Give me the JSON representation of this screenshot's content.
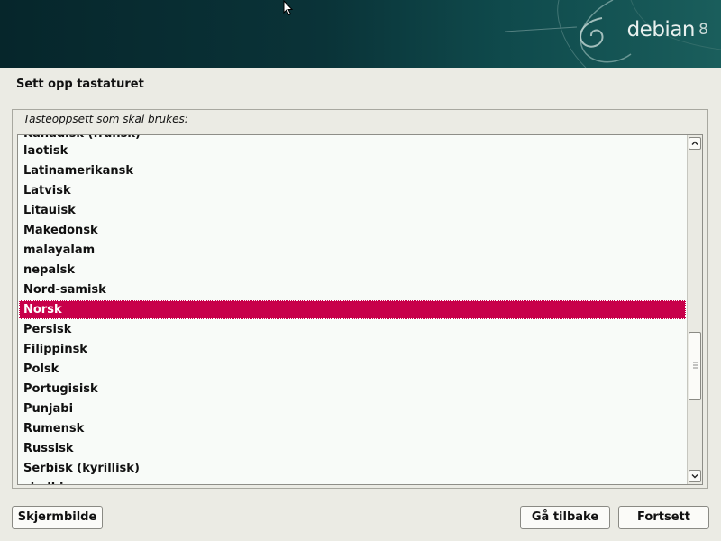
{
  "header": {
    "logo_text": "debian",
    "logo_version": "8"
  },
  "page": {
    "title": "Sett opp tastaturet"
  },
  "keyboard_list": {
    "legend": "Tasteoppsett som skal brukes:",
    "partial_top": "Kanadisk (fransk)",
    "items": [
      "laotisk",
      "Latinamerikansk",
      "Latvisk",
      "Litauisk",
      "Makedonsk",
      "malayalam",
      "nepalsk",
      "Nord-samisk",
      "Norsk",
      "Persisk",
      "Filippinsk",
      "Polsk",
      "Portugisisk",
      "Punjabi",
      "Rumensk",
      "Russisk",
      "Serbisk (kyrillisk)"
    ],
    "partial_bottom": "sindhi",
    "selected": "Norsk",
    "colors": {
      "selected_bg": "#c8004a",
      "selected_fg": "#ffffff"
    }
  },
  "buttons": {
    "screenshot": "Skjermbilde",
    "back": "Gå tilbake",
    "continue": "Fortsett"
  }
}
